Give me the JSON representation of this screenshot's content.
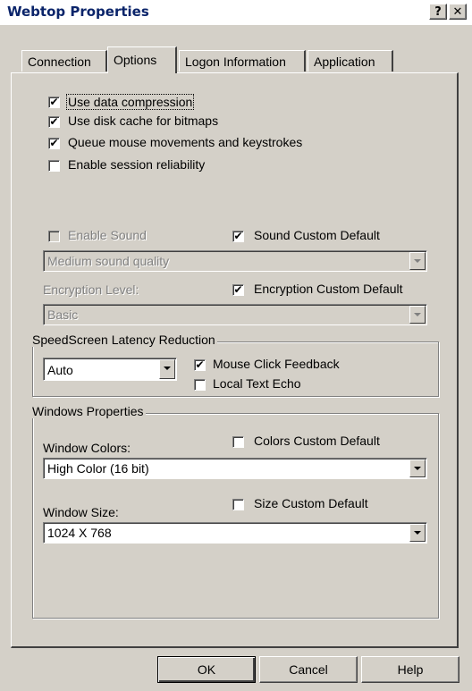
{
  "window": {
    "title": "Webtop Properties",
    "help_label": "?",
    "close_label": "✕"
  },
  "tabs": [
    {
      "label": "Connection"
    },
    {
      "label": "Options"
    },
    {
      "label": "Logon Information"
    },
    {
      "label": "Application"
    }
  ],
  "options": {
    "use_data_compression": {
      "label": "Use data compression",
      "checked": true
    },
    "use_disk_cache": {
      "label": "Use disk cache for bitmaps",
      "checked": true
    },
    "queue_mouse": {
      "label": "Queue mouse movements and keystrokes",
      "checked": true
    },
    "session_reliability": {
      "label": "Enable session reliability",
      "checked": false
    },
    "enable_sound": {
      "label": "Enable Sound",
      "checked": false
    },
    "sound_custom_default": {
      "label": "Sound Custom Default",
      "checked": true
    },
    "sound_quality": {
      "value": "Medium sound quality"
    },
    "encryption_level_label": "Encryption Level:",
    "encryption_custom_default": {
      "label": "Encryption Custom Default",
      "checked": true
    },
    "encryption_level": {
      "value": "Basic"
    }
  },
  "speedscreen": {
    "legend": "SpeedScreen Latency Reduction",
    "mode": "Auto",
    "mouse_click_feedback": {
      "label": "Mouse Click Feedback",
      "checked": true
    },
    "local_text_echo": {
      "label": "Local Text Echo",
      "checked": false
    }
  },
  "windows_properties": {
    "legend": "Windows Properties",
    "colors_label": "Window Colors:",
    "colors_custom_default": {
      "label": "Colors Custom Default",
      "checked": false
    },
    "colors_value": "High Color (16 bit)",
    "size_label": "Window Size:",
    "size_custom_default": {
      "label": "Size Custom Default",
      "checked": false
    },
    "size_value": "1024 X 768"
  },
  "buttons": {
    "ok": "OK",
    "cancel": "Cancel",
    "help": "Help"
  },
  "check_glyph": "✔"
}
